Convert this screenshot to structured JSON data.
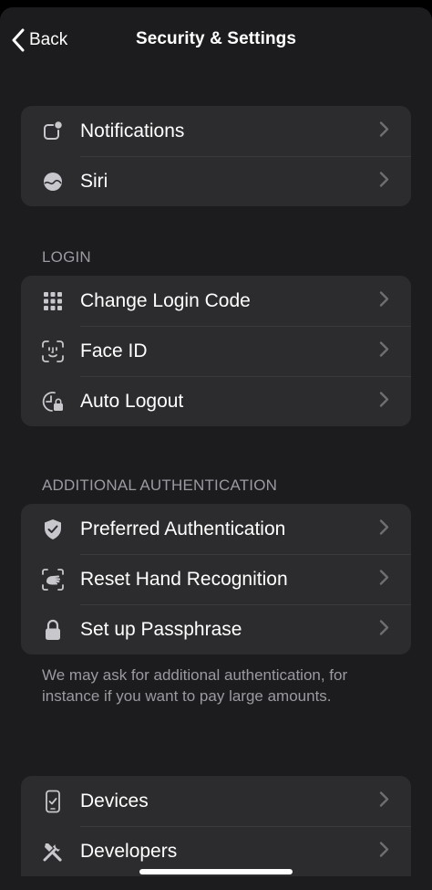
{
  "nav": {
    "back_label": "Back",
    "title": "Security & Settings"
  },
  "groups": {
    "general": [
      {
        "label": "Notifications",
        "icon": "notification-badge-icon"
      },
      {
        "label": "Siri",
        "icon": "siri-icon"
      }
    ],
    "login": {
      "header": "LOGIN",
      "items": [
        {
          "label": "Change Login Code",
          "icon": "keypad-grid-icon"
        },
        {
          "label": "Face ID",
          "icon": "face-id-icon"
        },
        {
          "label": "Auto Logout",
          "icon": "clock-lock-icon"
        }
      ]
    },
    "additional_auth": {
      "header": "ADDITIONAL AUTHENTICATION",
      "items": [
        {
          "label": "Preferred Authentication",
          "icon": "shield-check-icon"
        },
        {
          "label": "Reset Hand Recognition",
          "icon": "hand-scan-icon"
        },
        {
          "label": "Set up Passphrase",
          "icon": "lock-icon"
        }
      ],
      "footnote": "We may ask for additional authentication, for instance if you want to pay large amounts."
    },
    "other": [
      {
        "label": "Devices",
        "icon": "phone-check-icon"
      },
      {
        "label": "Developers",
        "icon": "tools-icon"
      }
    ]
  },
  "colors": {
    "background": "#000000",
    "sheet": "#1c1c1e",
    "cell": "#2c2c2e",
    "separator": "#3a3a3c",
    "secondary_text": "#9a9aa0",
    "icon": "#c7c7cc",
    "chevron": "#6e6e73"
  }
}
